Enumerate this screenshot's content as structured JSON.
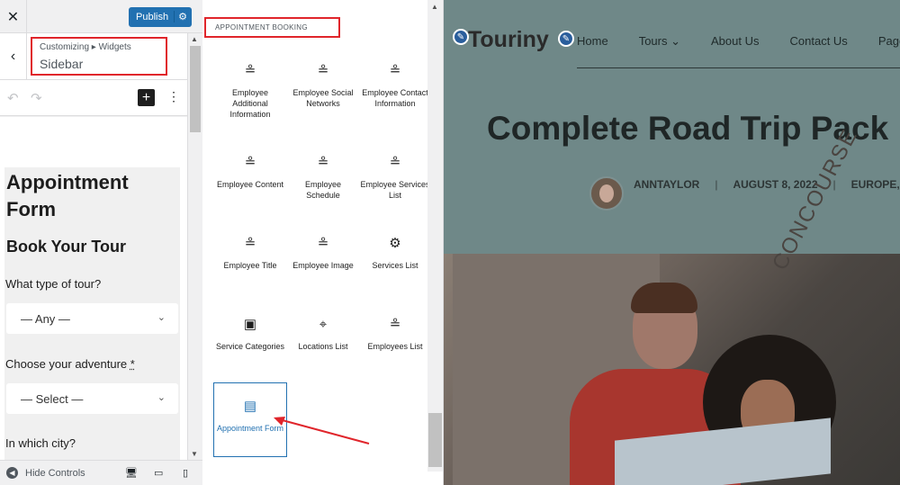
{
  "customizer": {
    "close_icon": "close-icon",
    "publish_label": "Publish",
    "breadcrumb": "Customizing ▸ Widgets",
    "section_title": "Sidebar",
    "hide_controls_label": "Hide Controls",
    "form": {
      "title": "Appointment Form",
      "subtitle": "Book Your Tour",
      "q1_label": "What type of tour?",
      "q1_value": "— Any —",
      "q2_label": "Choose your adventure",
      "q2_required": "*",
      "q2_value": "— Select —",
      "q3_label": "In which city?"
    }
  },
  "inserter": {
    "category": "APPOINTMENT BOOKING",
    "blocks": [
      {
        "label": "Employee Additional Information",
        "icon": "employee-icon"
      },
      {
        "label": "Employee Social Networks",
        "icon": "employee-icon"
      },
      {
        "label": "Employee Contact Information",
        "icon": "employee-icon"
      },
      {
        "label": "Employee Content",
        "icon": "employee-icon"
      },
      {
        "label": "Employee Schedule",
        "icon": "employee-icon"
      },
      {
        "label": "Employee Services List",
        "icon": "employee-icon"
      },
      {
        "label": "Employee Title",
        "icon": "employee-icon"
      },
      {
        "label": "Employee Image",
        "icon": "employee-icon"
      },
      {
        "label": "Services List",
        "icon": "services-gear-icon"
      },
      {
        "label": "Service Categories",
        "icon": "folder-gear-icon"
      },
      {
        "label": "Locations List",
        "icon": "location-icon"
      },
      {
        "label": "Employees List",
        "icon": "employee-icon"
      },
      {
        "label": "Appointment Form",
        "icon": "calendar-form-icon"
      }
    ]
  },
  "preview": {
    "logo": "Touriny",
    "nav": [
      "Home",
      "Tours",
      "About Us",
      "Contact Us",
      "Page"
    ],
    "post_title": "Complete Road Trip Pack",
    "author": "ANNTAYLOR",
    "date": "AUGUST 8, 2022",
    "category": "EUROPE, TO",
    "hero_text": "CONCOURSE"
  },
  "colors": {
    "accent": "#2271b1",
    "highlight_border": "#e0252b",
    "preview_overlay": "#6f8888"
  }
}
